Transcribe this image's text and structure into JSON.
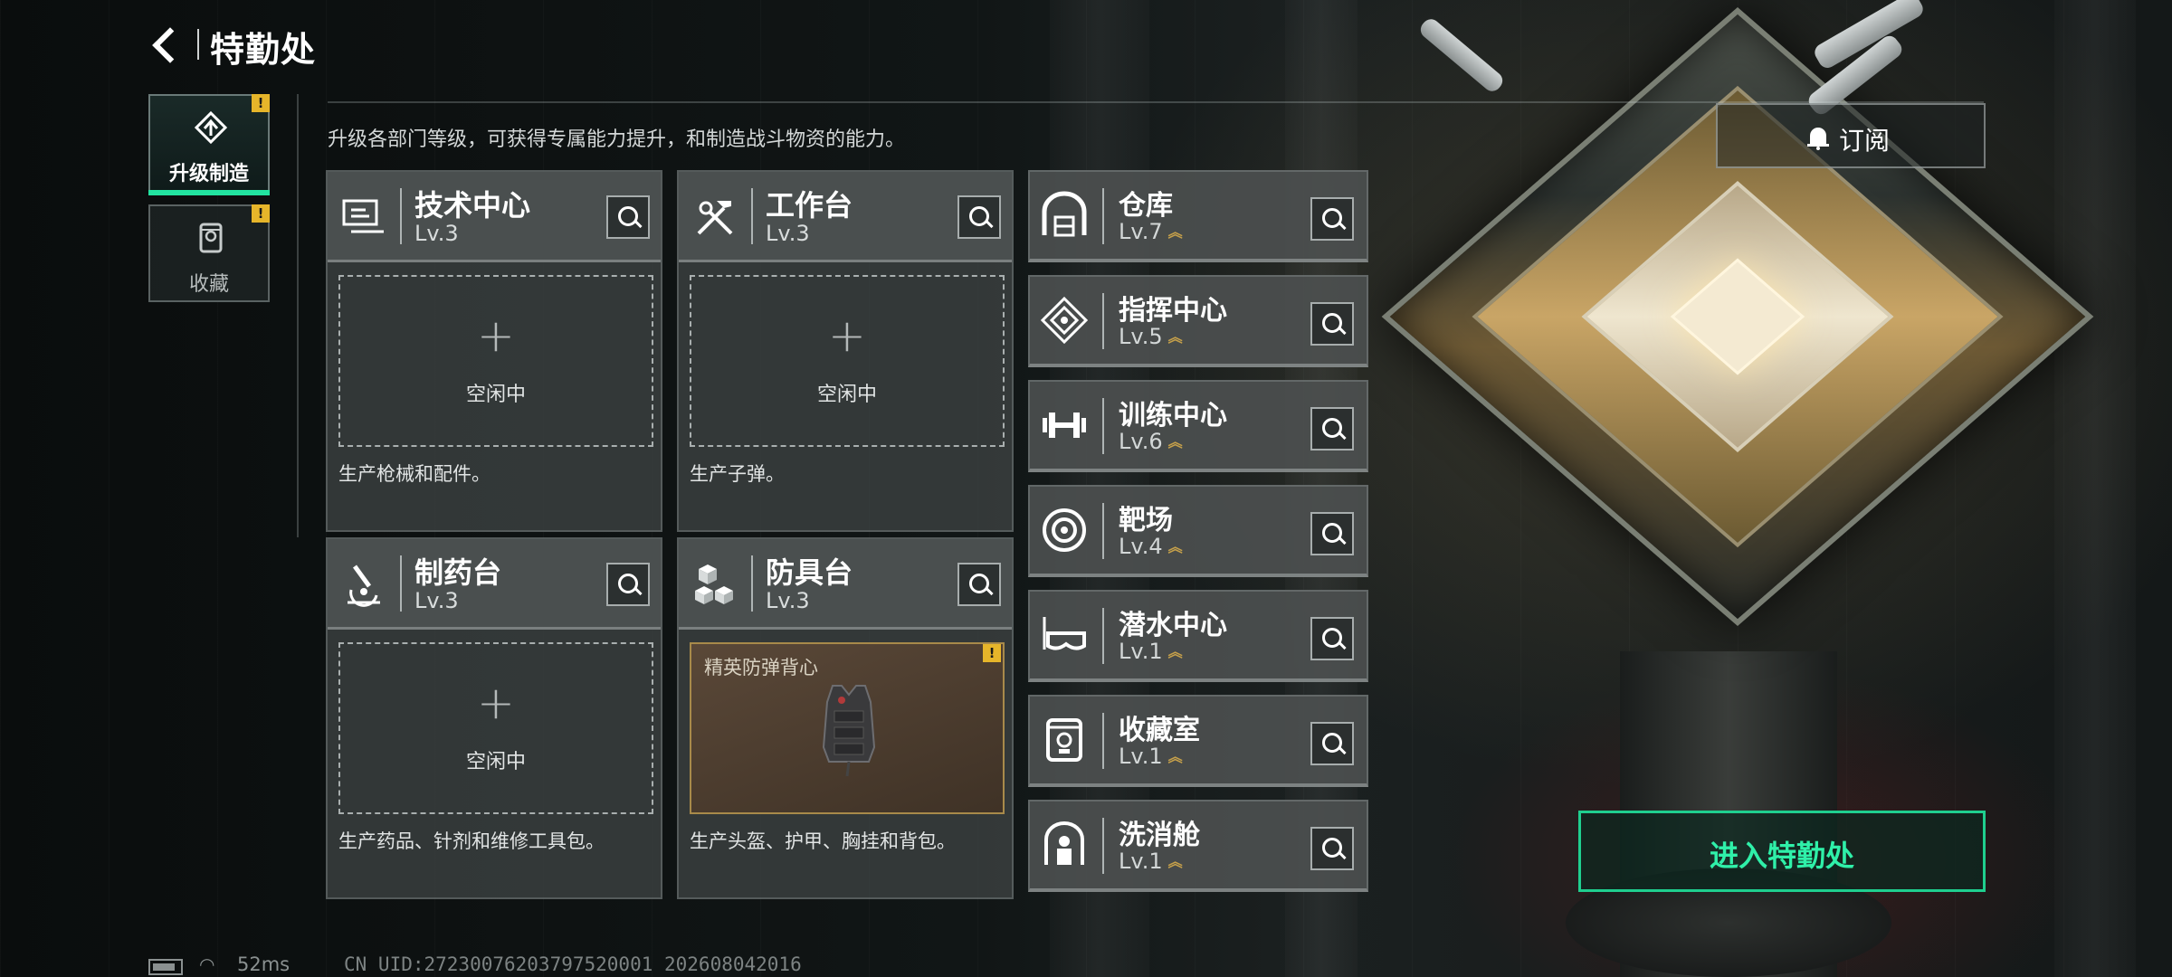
{
  "header": {
    "title": "特勤处"
  },
  "tabs": [
    {
      "label": "升级制造",
      "active": true,
      "badge": "!"
    },
    {
      "label": "收藏",
      "active": false,
      "badge": "!"
    }
  ],
  "description": "升级各部门等级，可获得专属能力提升，和制造战斗物资的能力。",
  "cards": [
    {
      "name": "技术中心",
      "level": "Lv.3",
      "icon": "computer-icon",
      "slot": {
        "plus": "+",
        "status": "空闲中"
      },
      "desc": "生产枪械和配件。"
    },
    {
      "name": "工作台",
      "level": "Lv.3",
      "icon": "tools-icon",
      "slot": {
        "plus": "+",
        "status": "空闲中"
      },
      "desc": "生产子弹。"
    },
    {
      "name": "制药台",
      "level": "Lv.3",
      "icon": "microscope-icon",
      "slot": {
        "plus": "+",
        "status": "空闲中"
      },
      "desc": "生产药品、针剂和维修工具包。"
    },
    {
      "name": "防具台",
      "level": "Lv.3",
      "icon": "armor-blocks-icon",
      "item": {
        "name": "精英防弹背心",
        "badge": "!"
      },
      "desc": "生产头盔、护甲、胸挂和背包。"
    }
  ],
  "facilities": [
    {
      "name": "仓库",
      "level": "Lv.7",
      "icon": "warehouse-icon",
      "upgrade": "︽"
    },
    {
      "name": "指挥中心",
      "level": "Lv.5",
      "icon": "command-icon",
      "upgrade": "︽"
    },
    {
      "name": "训练中心",
      "level": "Lv.6",
      "icon": "dumbbell-icon",
      "upgrade": "︽"
    },
    {
      "name": "靶场",
      "level": "Lv.4",
      "icon": "target-icon",
      "upgrade": "︽"
    },
    {
      "name": "潜水中心",
      "level": "Lv.1",
      "icon": "diving-mask-icon",
      "upgrade": "︽"
    },
    {
      "name": "收藏室",
      "level": "Lv.1",
      "icon": "trophy-case-icon",
      "upgrade": "︽"
    },
    {
      "name": "洗消舱",
      "level": "Lv.1",
      "icon": "decontamination-icon",
      "upgrade": "︽"
    }
  ],
  "subscribe": {
    "label": "订阅",
    "icon": "bell-icon"
  },
  "enter_button": "进入特勤处",
  "status": {
    "ping": "52ms",
    "uid": "CN UID:27230076203797520001 202608042016"
  },
  "colors": {
    "accent": "#22e3a0",
    "badge": "#e6b52a",
    "upgrade": "#c7a14a"
  }
}
